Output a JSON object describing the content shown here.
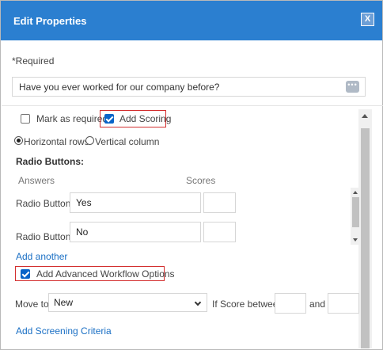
{
  "dialog": {
    "title": "Edit Properties",
    "close_label": "X"
  },
  "required_note": "*Required",
  "question": {
    "value": "Have you ever worked for our company before?",
    "more_label": "•••"
  },
  "options": {
    "mark_required": {
      "label": "Mark as required",
      "checked": false
    },
    "add_scoring": {
      "label": "Add Scoring",
      "checked": true
    }
  },
  "layout_choice": {
    "horizontal": {
      "label": "Horizontal rows",
      "selected": true
    },
    "vertical": {
      "label": "Vertical column",
      "selected": false
    }
  },
  "radio_section": {
    "heading": "Radio Buttons:",
    "answers_header": "Answers",
    "scores_header": "Scores",
    "rows": [
      {
        "label": "Radio Button 1",
        "answer": "Yes",
        "score": ""
      },
      {
        "label": "Radio Button 2",
        "answer": "No",
        "score": ""
      }
    ],
    "add_another": "Add another"
  },
  "advanced_workflow": {
    "label": "Add Advanced Workflow Options",
    "checked": true
  },
  "workflow": {
    "move_to_label": "Move to:",
    "move_to_value": "New",
    "score_between_label": "If Score between",
    "and_label": "and",
    "score_min": "",
    "score_max": ""
  },
  "screening_link": "Add Screening Criteria",
  "colors": {
    "titlebar": "#2b7fd0",
    "link": "#1a6fc4",
    "highlight_box": "#d32f2f",
    "checkbox_checked": "#0a64c8"
  }
}
